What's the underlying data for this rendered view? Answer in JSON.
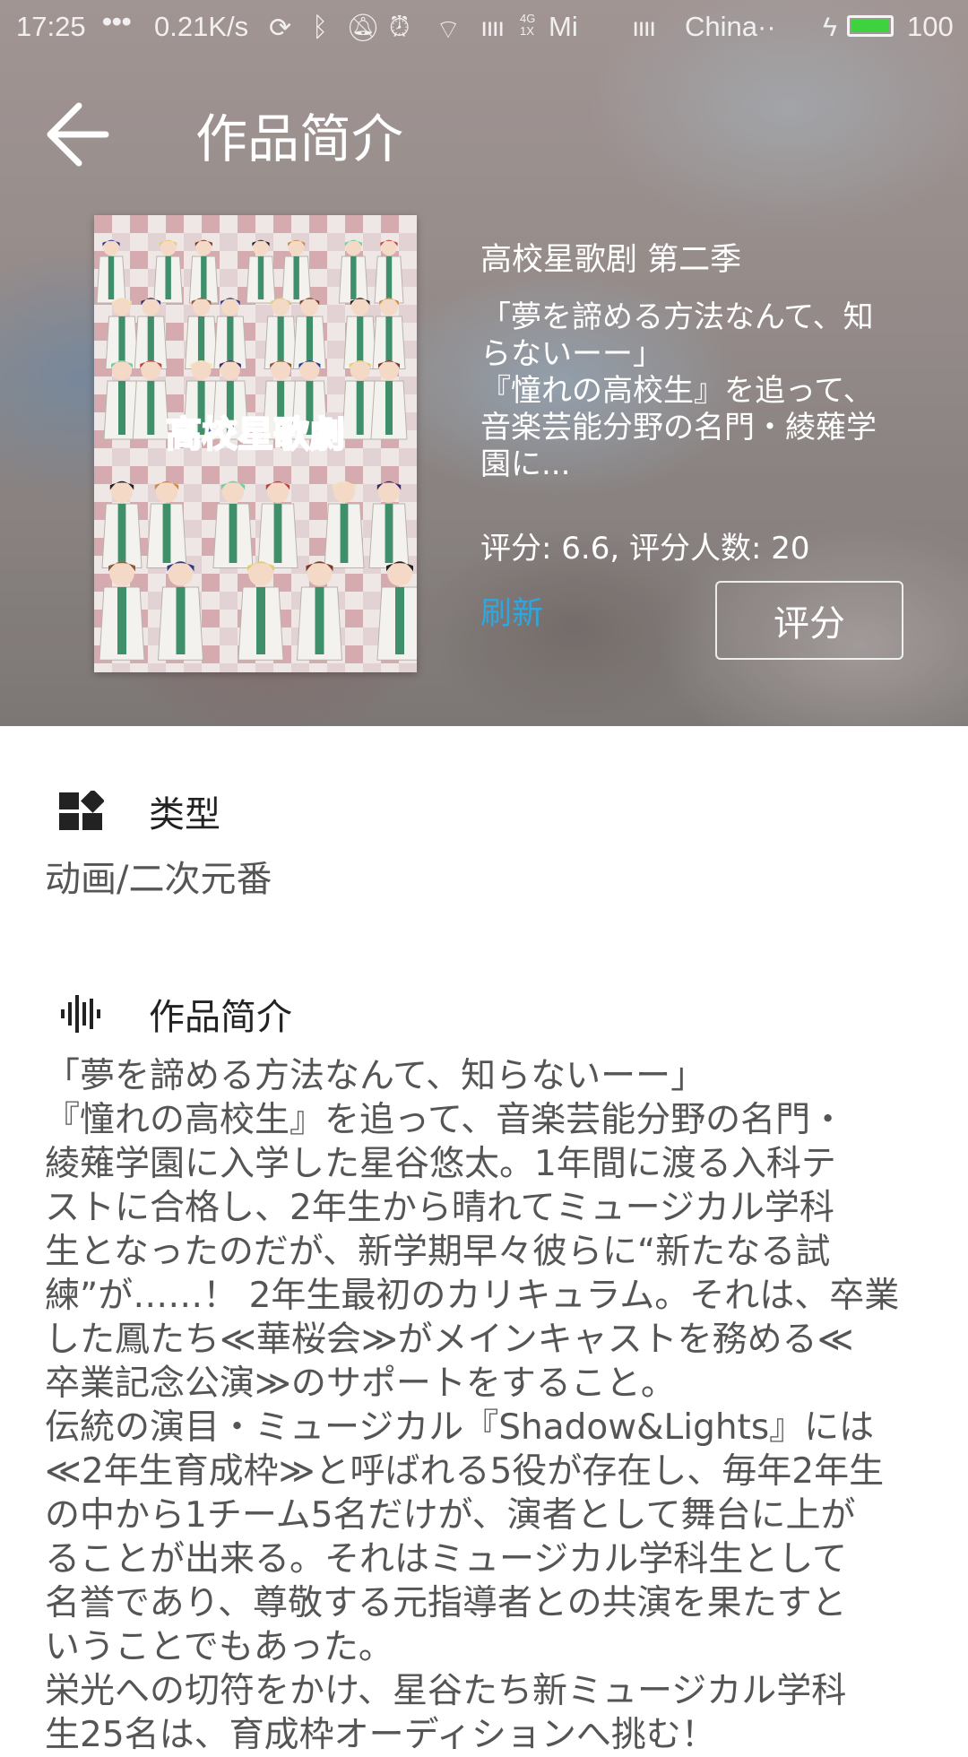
{
  "status_bar": {
    "time": "17:25",
    "dots": "•••",
    "net_speed": "0.21K/s",
    "network_badge": "4G 1X",
    "carrier1": "Mi",
    "carrier2": "China··",
    "battery_level": "100",
    "battery_fraction": 1.0
  },
  "appbar": {
    "back_icon": "arrow-left-icon",
    "title": "作品简介"
  },
  "show": {
    "title": "高校星歌剧 第二季",
    "short_desc": "「夢を諦める方法なんて、知らないーー」\n『憧れの高校生』を追って、音楽芸能分野の名門・綾薙学園に...",
    "rating_text": "评分: 6.6, 评分人数: 20",
    "refresh_label": "刷新",
    "rate_button_label": "评分",
    "poster_logo_text": "高校星歌劇"
  },
  "type_section": {
    "icon": "grid-icon",
    "label": "类型",
    "value": "动画/二次元番"
  },
  "synopsis_section": {
    "icon": "waveform-icon",
    "label": "作品简介",
    "text": "「夢を諦める方法なんて、知らないーー」\n『憧れの高校生』を追って、音楽芸能分野の名門・\n綾薙学園に入学した星谷悠太。1年間に渡る入科テ\nストに合格し、2年生から晴れてミュージカル学科\n生となったのだが、新学期早々彼らに“新たなる試\n練”が……！ 2年生最初のカリキュラム。それは、卒業\nした鳳たち≪華桜会≫がメインキャストを務める≪\n卒業記念公演≫のサポートをすること。\n伝統の演目・ミュージカル『Shadow&Lights』には\n≪2年生育成枠≫と呼ばれる5役が存在し、毎年2年生\nの中から1チーム5名だけが、演者として舞台に上が\nることが出来る。それはミュージカル学科生として\n名誉であり、尊敬する元指導者との共演を果たすと\nいうことでもあった。\n栄光への切符をかけ、星谷たち新ミュージカル学科\n生25名は、育成枠オーディションへ挑む！"
  },
  "colors": {
    "accent": "#2ea7e0",
    "battery": "#3ed23e"
  }
}
